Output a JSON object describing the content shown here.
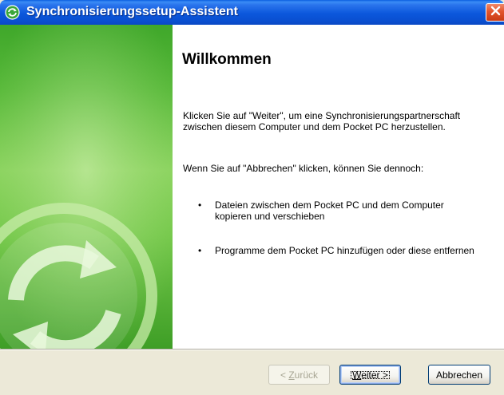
{
  "window": {
    "title": "Synchronisierungssetup-Assistent",
    "close_label": "×"
  },
  "content": {
    "heading": "Willkommen",
    "intro": "Klicken Sie auf \"Weiter\", um eine Synchronisierungspartnerschaft zwischen diesem Computer und dem Pocket PC herzustellen.",
    "cancel_note": "Wenn Sie auf \"Abbrechen\" klicken, können Sie dennoch:",
    "bullets": [
      "Dateien zwischen dem Pocket PC und dem Computer kopieren und verschieben",
      "Programme dem Pocket PC hinzufügen oder diese entfernen"
    ]
  },
  "buttons": {
    "back_prefix": "< ",
    "back_mnemonic": "Z",
    "back_rest": "urück",
    "next_mnemonic": "W",
    "next_rest": "eiter >",
    "cancel": "Abbrechen"
  },
  "icons": {
    "title_icon": "sync-icon",
    "watermark": "sync-arrows-icon"
  },
  "colors": {
    "titlebar": "#0a5fe0",
    "side_panel": "#58b93a",
    "close": "#e2542c"
  }
}
